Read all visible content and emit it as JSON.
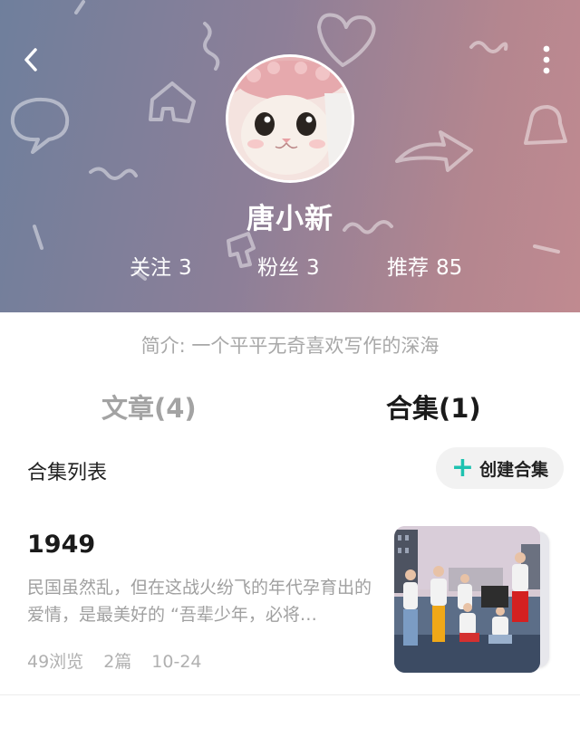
{
  "header": {
    "username": "唐小新",
    "stats": [
      {
        "label": "关注",
        "value": "3"
      },
      {
        "label": "粉丝",
        "value": "3"
      },
      {
        "label": "推荐",
        "value": "85"
      }
    ],
    "background_colors": [
      "#6f7f9c",
      "#b4868f"
    ],
    "icons": {
      "back": "back-arrow-icon",
      "more": "more-vertical-icon"
    }
  },
  "bio": "简介: 一个平平无奇喜欢写作的深海",
  "tabs": {
    "articles": "文章(4)",
    "collections": "合集(1)",
    "active": "collections"
  },
  "collections_section": {
    "title": "合集列表",
    "create_button": "创建合集",
    "accent_color": "#1ec2b0"
  },
  "collections": [
    {
      "title": "1949",
      "description": "民国虽然乱，但在这战火纷飞的年代孕育出的爱情，是最美好的 “吾辈少年，必将…",
      "views": "49浏览",
      "count": "2篇",
      "date": "10-24"
    }
  ]
}
